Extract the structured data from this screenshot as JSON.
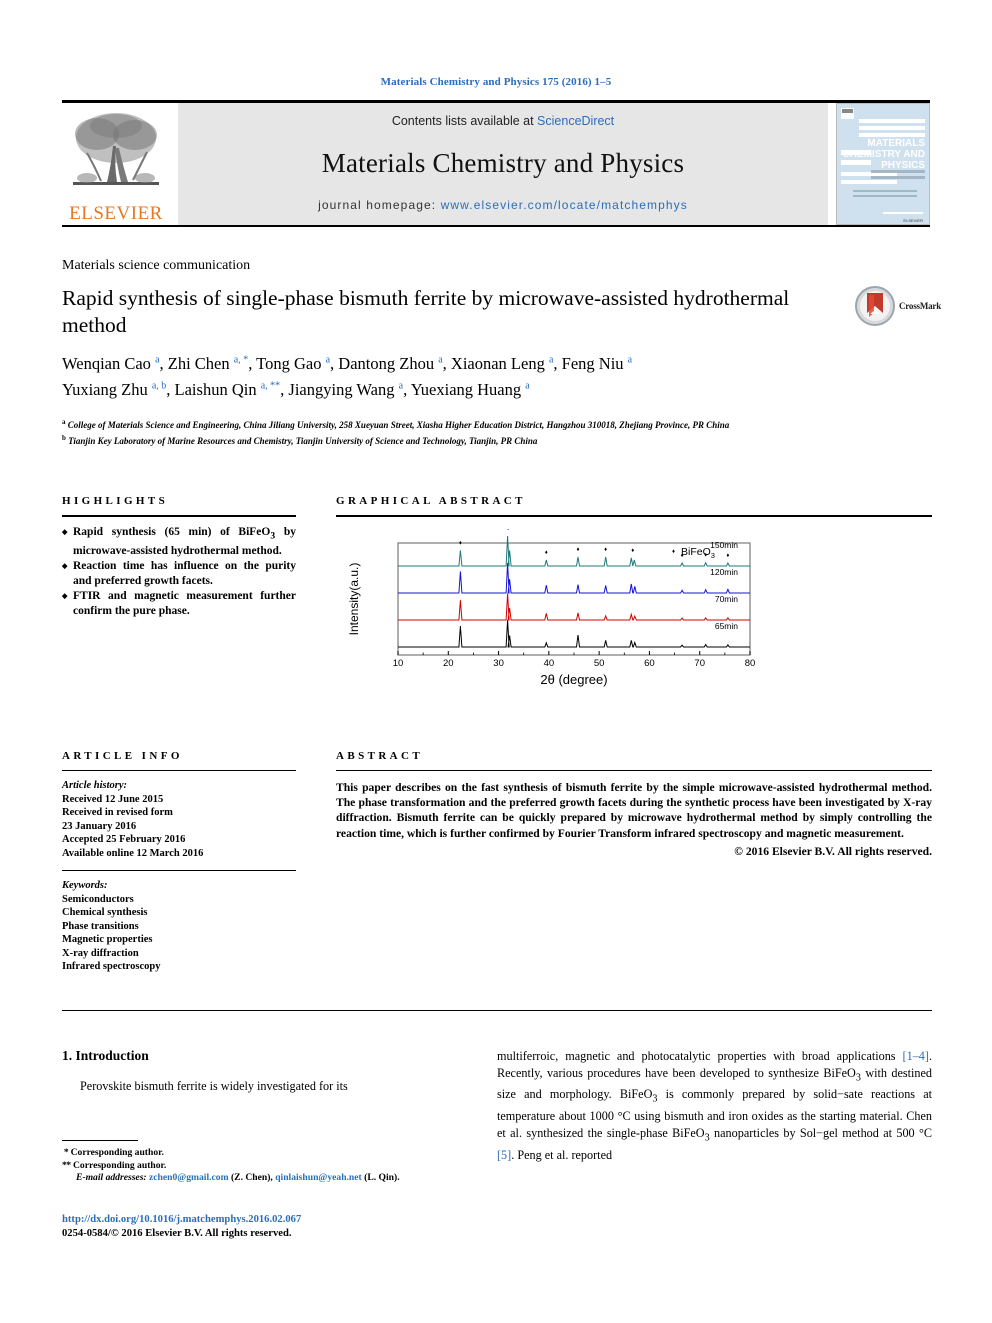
{
  "running_head": "Materials Chemistry and Physics 175 (2016) 1–5",
  "masthead": {
    "contents_prefix": "Contents lists available at ",
    "sciencedirect": "ScienceDirect",
    "journal_title": "Materials Chemistry and Physics",
    "homepage_prefix": "journal homepage: ",
    "homepage_url": "www.elsevier.com/locate/matchemphys",
    "publisher": "ELSEVIER",
    "cover": {
      "line1": "MATERIALS",
      "line2": "CHEMISTRY AND",
      "line3": "PHYSICS"
    },
    "accent_blue": "#2a6ebb",
    "elsevier_orange": "#E87722",
    "panel_grey": "#e6e6e6"
  },
  "article_type": "Materials science communication",
  "title": "Rapid synthesis of single-phase bismuth ferrite by microwave-assisted hydrothermal method",
  "crossmark": {
    "label": "CrossMark"
  },
  "authors_line1": [
    {
      "name": "Wenqian Cao",
      "marks": "a"
    },
    {
      "name": "Zhi Chen",
      "marks": "a, *"
    },
    {
      "name": "Tong Gao",
      "marks": "a"
    },
    {
      "name": "Dantong Zhou",
      "marks": "a"
    },
    {
      "name": "Xiaonan Leng",
      "marks": "a"
    },
    {
      "name": "Feng Niu",
      "marks": "a"
    }
  ],
  "authors_line2": [
    {
      "name": "Yuxiang Zhu",
      "marks": "a, b"
    },
    {
      "name": "Laishun Qin",
      "marks": "a, **"
    },
    {
      "name": "Jiangying Wang",
      "marks": "a"
    },
    {
      "name": "Yuexiang Huang",
      "marks": "a"
    }
  ],
  "affiliations": [
    {
      "mark": "a",
      "text": "College of Materials Science and Engineering, China Jiliang University, 258 Xueyuan Street, Xiasha Higher Education District, Hangzhou 310018, Zhejiang Province, PR China"
    },
    {
      "mark": "b",
      "text": "Tianjin Key Laboratory of Marine Resources and Chemistry, Tianjin University of Science and Technology, Tianjin, PR China"
    }
  ],
  "highlights": {
    "heading": "HIGHLIGHTS",
    "items": [
      "Rapid synthesis (65 min) of BiFeO₃ by microwave-assisted hydrothermal method.",
      "Reaction time has influence on the purity and preferred growth facets.",
      "FTIR and magnetic measurement further confirm the pure phase."
    ]
  },
  "graphical_abstract": {
    "heading": "GRAPHICAL ABSTRACT"
  },
  "chart_data": {
    "type": "line",
    "title": "",
    "xlabel": "2θ (degree)",
    "ylabel": "Intensity(a.u.)",
    "xlim": [
      10,
      80
    ],
    "xticks": [
      10,
      20,
      30,
      40,
      50,
      60,
      70,
      80
    ],
    "grid": false,
    "legend": {
      "marker": "♦",
      "label": "BiFeO₃",
      "position": "top-right"
    },
    "peak_positions_deg": [
      22.4,
      31.8,
      32.1,
      39.5,
      45.8,
      51.3,
      56.4,
      57.0,
      66.5,
      71.2,
      75.6
    ],
    "peak_markers_deg": [
      22.4,
      31.9,
      39.5,
      45.8,
      51.3,
      56.7,
      66.5,
      71.2,
      75.6
    ],
    "series": [
      {
        "name": "150min",
        "color": "#1f7a7a",
        "label": "150min",
        "peaks": [
          {
            "x": 22.4,
            "h": 0.52
          },
          {
            "x": 31.8,
            "h": 1.0
          },
          {
            "x": 32.2,
            "h": 0.52
          },
          {
            "x": 39.5,
            "h": 0.2
          },
          {
            "x": 45.8,
            "h": 0.3
          },
          {
            "x": 51.3,
            "h": 0.3
          },
          {
            "x": 56.4,
            "h": 0.27
          },
          {
            "x": 57.0,
            "h": 0.2
          },
          {
            "x": 66.5,
            "h": 0.1
          },
          {
            "x": 71.2,
            "h": 0.11
          },
          {
            "x": 75.6,
            "h": 0.1
          }
        ]
      },
      {
        "name": "120min",
        "color": "#1414d2",
        "label": "120min",
        "peaks": [
          {
            "x": 22.4,
            "h": 0.72
          },
          {
            "x": 31.8,
            "h": 1.0
          },
          {
            "x": 32.2,
            "h": 0.46
          },
          {
            "x": 39.5,
            "h": 0.26
          },
          {
            "x": 45.8,
            "h": 0.28
          },
          {
            "x": 51.3,
            "h": 0.25
          },
          {
            "x": 56.4,
            "h": 0.3
          },
          {
            "x": 57.1,
            "h": 0.22
          },
          {
            "x": 66.5,
            "h": 0.09
          },
          {
            "x": 71.2,
            "h": 0.11
          },
          {
            "x": 75.6,
            "h": 0.12
          }
        ]
      },
      {
        "name": "70min",
        "color": "#d40000",
        "label": "70min",
        "peaks": [
          {
            "x": 22.4,
            "h": 0.66
          },
          {
            "x": 31.8,
            "h": 0.88
          },
          {
            "x": 32.2,
            "h": 0.4
          },
          {
            "x": 39.5,
            "h": 0.22
          },
          {
            "x": 45.8,
            "h": 0.24
          },
          {
            "x": 51.3,
            "h": 0.14
          },
          {
            "x": 56.4,
            "h": 0.19
          },
          {
            "x": 57.1,
            "h": 0.13
          },
          {
            "x": 66.5,
            "h": 0.06
          },
          {
            "x": 71.2,
            "h": 0.07
          },
          {
            "x": 75.6,
            "h": 0.07
          }
        ]
      },
      {
        "name": "65min",
        "color": "#000000",
        "label": "65min",
        "peaks": [
          {
            "x": 22.4,
            "h": 0.7
          },
          {
            "x": 31.8,
            "h": 0.9
          },
          {
            "x": 32.2,
            "h": 0.38
          },
          {
            "x": 39.5,
            "h": 0.14
          },
          {
            "x": 45.8,
            "h": 0.4
          },
          {
            "x": 51.3,
            "h": 0.22
          },
          {
            "x": 56.4,
            "h": 0.22
          },
          {
            "x": 57.1,
            "h": 0.15
          },
          {
            "x": 66.5,
            "h": 0.06
          },
          {
            "x": 71.2,
            "h": 0.08
          },
          {
            "x": 75.6,
            "h": 0.07
          }
        ]
      }
    ]
  },
  "article_info": {
    "heading": "ARTICLE INFO",
    "history_label": "Article history:",
    "history": [
      "Received 12 June 2015",
      "Received in revised form",
      "23 January 2016",
      "Accepted 25 February 2016",
      "Available online 12 March 2016"
    ],
    "keywords_label": "Keywords:",
    "keywords": [
      "Semiconductors",
      "Chemical synthesis",
      "Phase transitions",
      "Magnetic properties",
      "X-ray diffraction",
      "Infrared spectroscopy"
    ]
  },
  "abstract": {
    "heading": "ABSTRACT",
    "text": "This paper describes on the fast synthesis of bismuth ferrite by the simple microwave-assisted hydrothermal method. The phase transformation and the preferred growth facets during the synthetic process have been investigated by X-ray diffraction. Bismuth ferrite can be quickly prepared by microwave hydrothermal method by simply controlling the reaction time, which is further confirmed by Fourier Transform infrared spectroscopy and magnetic measurement.",
    "copyright": "© 2016 Elsevier B.V. All rights reserved."
  },
  "body": {
    "section_number_title": "1. Introduction",
    "left_paragraph": "Perovskite bismuth ferrite is widely investigated for its",
    "right_paragraph_parts": [
      "multiferroic, magnetic and photocatalytic properties with broad applications ",
      "[1–4]",
      ". Recently, various procedures have been developed to synthesize BiFeO₃ with destined size and morphology. BiFeO₃ is commonly prepared by solid−sate reactions at temperature about 1000 °C using bismuth and iron oxides as the starting material. Chen et al. synthesized the single-phase BiFeO₃ nanoparticles by Sol−gel method at 500 °C ",
      "[5]",
      ". Peng et al. reported"
    ]
  },
  "footnotes": {
    "corresponding1": "Corresponding author.",
    "corresponding2": "Corresponding author.",
    "email_label": "E-mail addresses:",
    "email1": "zchen0@gmail.com",
    "email1_owner": "(Z. Chen)",
    "email2": "qinlaishun@yeah.net",
    "email2_owner": "(L. Qin)."
  },
  "doi": {
    "url": "http://dx.doi.org/10.1016/j.matchemphys.2016.02.067",
    "issn_line": "0254-0584/© 2016 Elsevier B.V. All rights reserved."
  }
}
